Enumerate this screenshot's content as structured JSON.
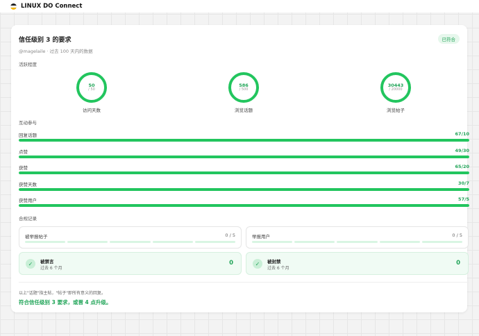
{
  "app": {
    "brand": "LINUX DO Connect"
  },
  "card": {
    "title": "信任级别 3 的要求",
    "badge": "已符合",
    "subtitle": "@magelaile · 过去 100 天内的数据"
  },
  "activity": {
    "label": "活跃程度",
    "rings": [
      {
        "value": "50",
        "max": "/ 50",
        "label": "访问天数"
      },
      {
        "value": "586",
        "max": "/ 500",
        "label": "浏览话题"
      },
      {
        "value": "30443",
        "max": "/ 20000",
        "label": "浏览帖子"
      }
    ]
  },
  "interaction": {
    "label": "互动参与",
    "bars": [
      {
        "label": "回复话题",
        "value": "67/10",
        "progress": 1.0
      },
      {
        "label": "点赞",
        "value": "49/30",
        "progress": 1.0
      },
      {
        "label": "获赞",
        "value": "65/20",
        "progress": 1.0
      },
      {
        "label": "获赞天数",
        "value": "30/7",
        "progress": 1.0
      },
      {
        "label": "获赞用户",
        "value": "57/5",
        "progress": 1.0
      }
    ]
  },
  "compliance": {
    "label": "合规记录",
    "flagged_posts": {
      "label": "被举报帖子",
      "value": "0 / 5"
    },
    "flagged_users": {
      "label": "举报用户",
      "value": "0 / 5"
    },
    "silenced": {
      "title": "被禁言",
      "sub": "过去 6 个月",
      "value": "0"
    },
    "suspended": {
      "title": "被封禁",
      "sub": "过去 6 个月",
      "value": "0"
    }
  },
  "footer": {
    "note": "以上\"话题\"指主帖，\"帖子\"即所有意义的回复。",
    "result": "符合信任级别 3 要求，或晋 4 点升级。"
  },
  "colors": {
    "accent": "#22c55e",
    "accent_text": "#22a559",
    "track": "#dcfce7"
  }
}
